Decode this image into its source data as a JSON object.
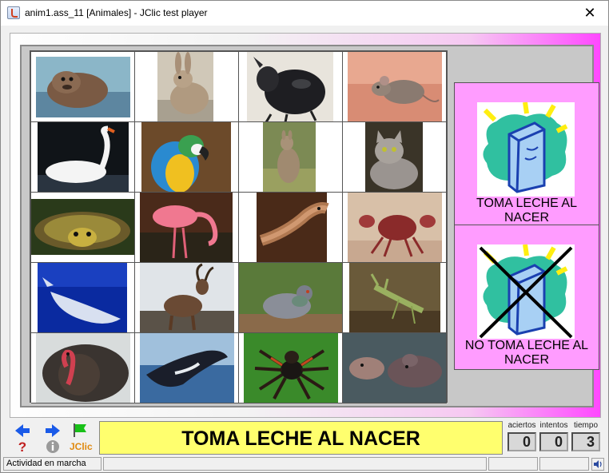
{
  "window": {
    "title": "anim1.ass_11 [Animales] - JClic test player",
    "close": "✕"
  },
  "grid": {
    "cells": [
      "sea-lion",
      "rabbit",
      "beetle",
      "mouse",
      "swan",
      "macaw",
      "kangaroo",
      "cat",
      "turtle",
      "flamingo",
      "snake",
      "crab",
      "whale",
      "ibex",
      "pigeon",
      "mantis",
      "turkey",
      "humpback-whale",
      "spider",
      "hippo"
    ]
  },
  "categories": {
    "milk": "TOMA LECHE AL NACER",
    "no_milk": "NO TOMA LECHE AL NACER"
  },
  "toolbar": {
    "jclic_label": "JClic"
  },
  "message": "TOMA LECHE AL NACER",
  "counters": {
    "aciertos_label": "aciertos",
    "aciertos": "0",
    "intentos_label": "intentos",
    "intentos": "0",
    "tiempo_label": "tiempo",
    "tiempo": "3"
  },
  "status": {
    "text": "Actividad en marcha"
  },
  "colors": {
    "stage_accent": "#ff48ff",
    "side_bg": "#ff9cff",
    "message_bg": "#ffff6e"
  }
}
